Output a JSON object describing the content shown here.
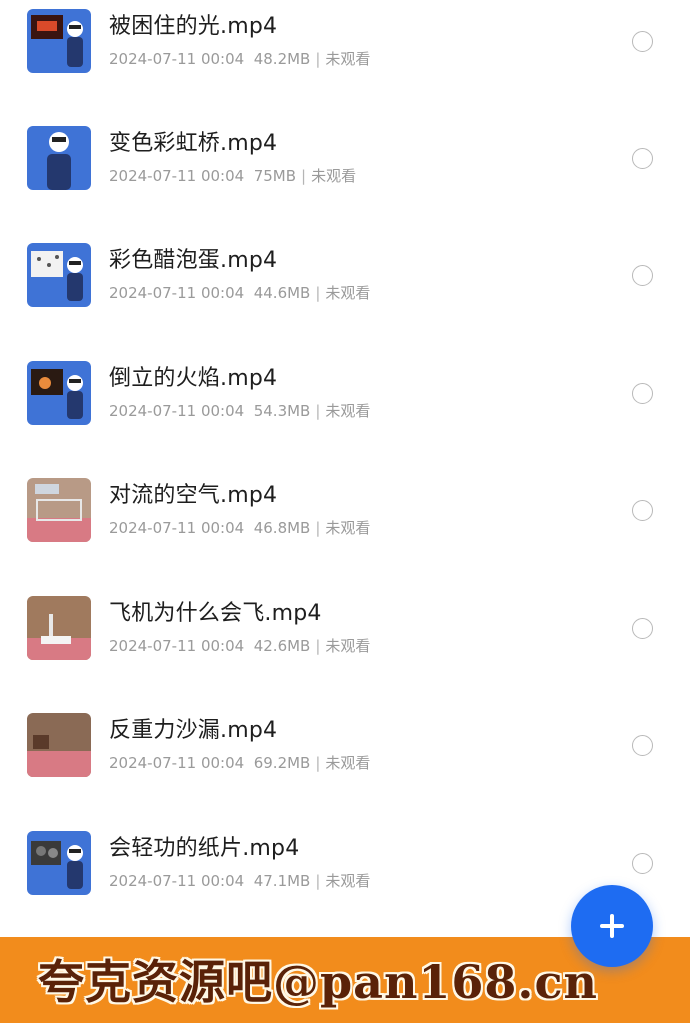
{
  "files": [
    {
      "name": "被困住的光.mp4",
      "date": "2024-07-11 00:04",
      "size": "48.2MB",
      "status": "未观看",
      "thumb_icon": "video-thumbnail-blue-presenter"
    },
    {
      "name": "变色彩虹桥.mp4",
      "date": "2024-07-11 00:04",
      "size": "75MB",
      "status": "未观看",
      "thumb_icon": "video-thumbnail-blue-presenter"
    },
    {
      "name": "彩色醋泡蛋.mp4",
      "date": "2024-07-11 00:04",
      "size": "44.6MB",
      "status": "未观看",
      "thumb_icon": "video-thumbnail-blue-presenter"
    },
    {
      "name": "倒立的火焰.mp4",
      "date": "2024-07-11 00:04",
      "size": "54.3MB",
      "status": "未观看",
      "thumb_icon": "video-thumbnail-blue-presenter"
    },
    {
      "name": "对流的空气.mp4",
      "date": "2024-07-11 00:04",
      "size": "46.8MB",
      "status": "未观看",
      "thumb_icon": "video-thumbnail-pink-table"
    },
    {
      "name": "飞机为什么会飞.mp4",
      "date": "2024-07-11 00:04",
      "size": "42.6MB",
      "status": "未观看",
      "thumb_icon": "video-thumbnail-pink-table"
    },
    {
      "name": "反重力沙漏.mp4",
      "date": "2024-07-11 00:04",
      "size": "69.2MB",
      "status": "未观看",
      "thumb_icon": "video-thumbnail-pink-table"
    },
    {
      "name": "会轻功的纸片.mp4",
      "date": "2024-07-11 00:04",
      "size": "47.1MB",
      "status": "未观看",
      "thumb_icon": "video-thumbnail-blue-presenter"
    }
  ],
  "fab": {
    "icon": "plus-icon"
  },
  "watermark": {
    "text": "夸克资源吧@pan168.cn"
  },
  "colors": {
    "accent": "#1e6cf2",
    "thumb_blue": "#3f73d6",
    "thumb_pink": "#d87a84",
    "watermark_bg": "#f28c1c"
  }
}
